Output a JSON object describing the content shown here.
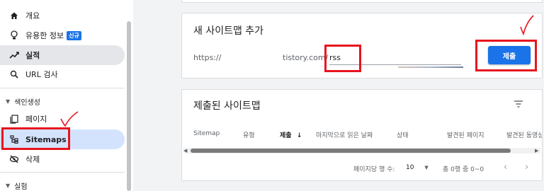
{
  "sidebar": {
    "items": [
      {
        "label": "개요",
        "icon": "home-icon"
      },
      {
        "label": "유용한 정보",
        "badge": "신규",
        "icon": "lightbulb-icon"
      },
      {
        "label": "실적",
        "icon": "trending-icon"
      },
      {
        "label": "URL 검사",
        "icon": "search-icon"
      }
    ],
    "index_section": "색인생성",
    "index_items": [
      {
        "label": "페이지",
        "icon": "pages-icon"
      },
      {
        "label": "Sitemaps",
        "icon": "sitemap-icon"
      },
      {
        "label": "삭제",
        "icon": "eye-off-icon"
      }
    ],
    "experience_section": "실험"
  },
  "add_card": {
    "title": "새 사이트맵 추가",
    "url_prefix": "https://",
    "url_domain": "tistory.com/",
    "input_value": "rss",
    "submit_label": "제출"
  },
  "submitted_card": {
    "title": "제출된 사이트맵",
    "columns": [
      "Sitemap",
      "유형",
      "제출",
      "마지막으로 읽은 날짜",
      "상태",
      "발견된 페이지",
      "발견된 동영상"
    ],
    "sorted_column_index": 2,
    "rows_per_page_label": "페이지당 행 수:",
    "rows_per_page_value": "10",
    "range_label": "총 0행 중 0~0"
  },
  "colors": {
    "accent": "#1a73e8",
    "annotation_red": "#e8141e"
  }
}
